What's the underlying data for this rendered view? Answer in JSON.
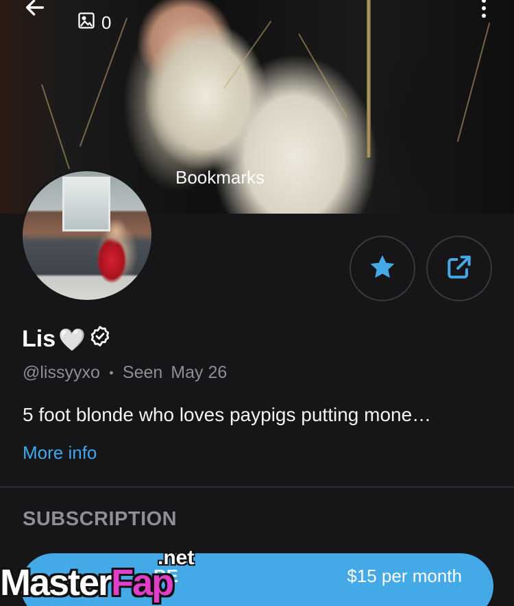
{
  "header": {
    "back_icon": "arrow-left-icon",
    "media_icon": "image-icon",
    "media_count": "0",
    "more_icon": "more-vertical-icon",
    "bookmarks_label": "Bookmarks"
  },
  "profile": {
    "display_name": "Lis",
    "name_emoji": "🤍",
    "verified_icon": "verified-badge-icon",
    "handle": "@lissyyxo",
    "seen_label": "Seen",
    "seen_date": "May 26",
    "bio": "5 foot blonde who loves paypigs putting mone…",
    "more_info_label": "More info"
  },
  "actions": {
    "star_icon": "star-icon",
    "share_icon": "share-icon"
  },
  "subscription": {
    "section_title": "SUBSCRIPTION",
    "button_label": "BE",
    "price": "$15 per month"
  },
  "watermark": {
    "part1": "Master",
    "part2": "Fap",
    "suffix": ".net"
  },
  "colors": {
    "accent": "#44a9e7",
    "link": "#3ea9ee",
    "background": "#161618",
    "muted_text": "#8e8e93"
  }
}
